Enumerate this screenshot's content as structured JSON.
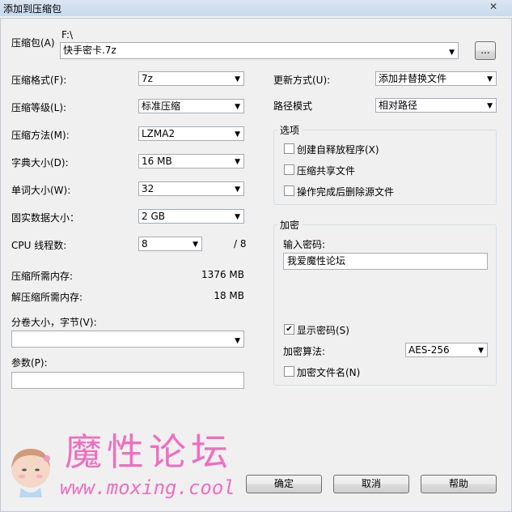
{
  "window": {
    "title": "添加到压缩包",
    "close_glyph": "✕"
  },
  "archive": {
    "label": "压缩包(A)",
    "path_prefix": "F:\\",
    "name": "快手密卡.7z",
    "browse_label": "..."
  },
  "left": {
    "format": {
      "label": "压缩格式(F):",
      "value": "7z"
    },
    "level": {
      "label": "压缩等级(L):",
      "value": "标准压缩"
    },
    "method": {
      "label": "压缩方法(M):",
      "value": "LZMA2"
    },
    "dict": {
      "label": "字典大小(D):",
      "value": "16 MB"
    },
    "word": {
      "label": "单词大小(W):",
      "value": "32"
    },
    "solid": {
      "label": "固实数据大小：",
      "value": "2 GB"
    },
    "threads": {
      "label": "CPU 线程数:",
      "value": "8",
      "total": "/ 8"
    },
    "mem_compress": {
      "label": "压缩所需内存:",
      "value": "1376 MB"
    },
    "mem_decompress": {
      "label": "解压缩所需内存:",
      "value": "18 MB"
    },
    "split": {
      "label": "分卷大小，字节(V):",
      "value": ""
    },
    "params": {
      "label": "参数(P):",
      "value": ""
    }
  },
  "right": {
    "update": {
      "label": "更新方式(U):",
      "value": "添加并替换文件"
    },
    "path_mode": {
      "label": "路径模式",
      "value": "相对路径"
    },
    "options": {
      "title": "选项",
      "sfx": {
        "label": "创建自释放程序(X)",
        "checked": false
      },
      "shared": {
        "label": "压缩共享文件",
        "checked": false
      },
      "delete": {
        "label": "操作完成后删除源文件",
        "checked": false
      }
    },
    "encryption": {
      "title": "加密",
      "password_label": "输入密码:",
      "password_value": "我爱魔性论坛",
      "show_password": {
        "label": "显示密码(S)",
        "checked": true
      },
      "method_label": "加密算法:",
      "method_value": "AES-256",
      "encrypt_names": {
        "label": "加密文件名(N)",
        "checked": false
      }
    }
  },
  "buttons": {
    "ok": "确定",
    "cancel": "取消",
    "help": "帮助"
  },
  "watermark": {
    "title": "魔性论坛",
    "url": "www.moxing.cool"
  }
}
